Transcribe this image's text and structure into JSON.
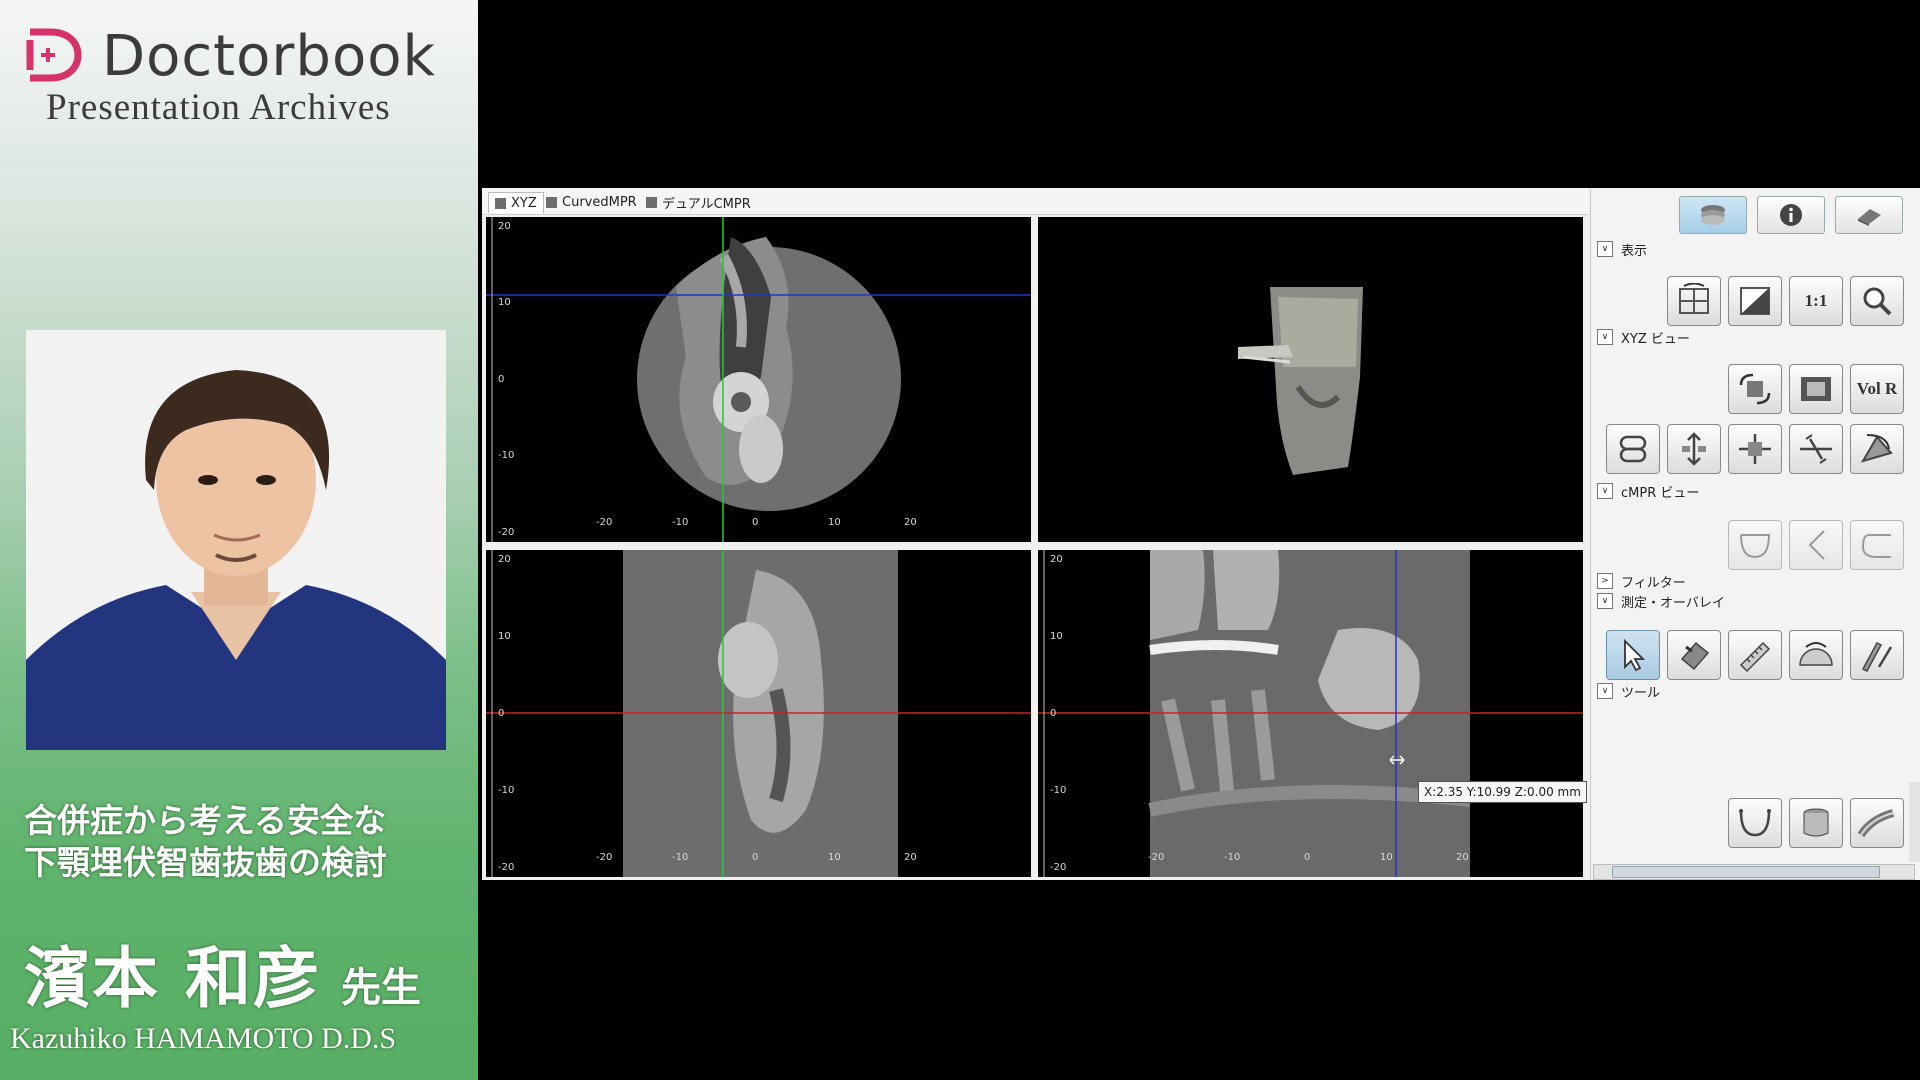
{
  "brand": {
    "name": "Doctorbook",
    "subtitle": "Presentation Archives",
    "mark_color": "#d6336c"
  },
  "talk": {
    "title_line1": "合併症から考える安全な",
    "title_line2": "下顎埋伏智歯抜歯の検討",
    "speaker_jp": "濱本 和彦",
    "honorific": "先生",
    "speaker_en": "Kazuhiko HAMAMOTO D.D.S"
  },
  "app": {
    "tabs": [
      {
        "label": "XYZ",
        "icon": "xyz-view-icon"
      },
      {
        "label": "CurvedMPR",
        "icon": "curved-mpr-icon"
      },
      {
        "label": "デュアルCMPR",
        "icon": "dual-cmpr-icon"
      }
    ],
    "ruler_labels": [
      "20",
      "10",
      "0",
      "-10",
      "-20"
    ],
    "axis_labels": [
      "-20",
      "-10",
      "0",
      "10",
      "20"
    ],
    "coordinate_readout": "X:2.35 Y:10.99 Z:0.00 mm",
    "crosshair_colors": {
      "blue": "#2233cc",
      "green": "#22cc33",
      "red": "#cc2222"
    }
  },
  "panel": {
    "top_tabs": [
      {
        "name": "layers-tab-icon"
      },
      {
        "name": "info-tab-icon"
      },
      {
        "name": "eraser-tab-icon"
      }
    ],
    "sections": {
      "display": "表示",
      "xyz_view": "XYZ ビュー",
      "cmpr_view": "cMPR ビュー",
      "filter": "フィルター",
      "measure": "測定・オーバレイ",
      "tools": "ツール"
    },
    "volr_label": "Vol R",
    "ratio_label": "1:1",
    "collapse_glyph": "∨",
    "expand_glyph": ">"
  }
}
